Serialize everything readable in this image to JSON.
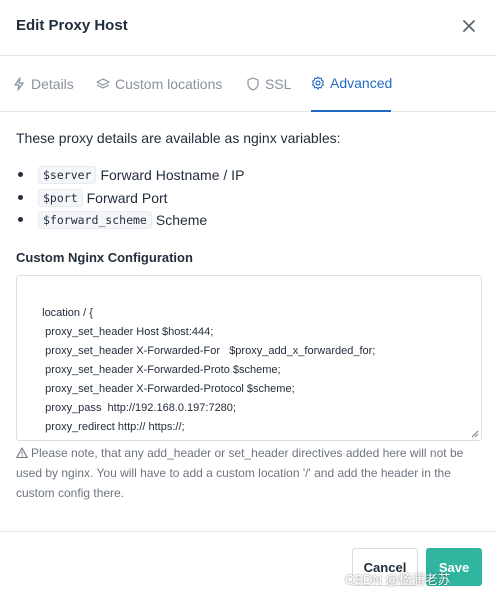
{
  "dialog": {
    "title": "Edit Proxy Host"
  },
  "tabs": [
    {
      "label": "Details",
      "icon": "lightning-icon"
    },
    {
      "label": "Custom locations",
      "icon": "layers-icon"
    },
    {
      "label": "SSL",
      "icon": "shield-icon"
    },
    {
      "label": "Advanced",
      "icon": "gear-icon",
      "active": true
    }
  ],
  "advanced": {
    "intro": "These proxy details are available as nginx variables:",
    "variables": [
      {
        "code": "$server",
        "description": "Forward Hostname / IP"
      },
      {
        "code": "$port",
        "description": "Forward Port"
      },
      {
        "code": "$forward_scheme",
        "description": "Scheme"
      }
    ],
    "config_label": "Custom Nginx Configuration",
    "config_value": "location / {\n   proxy_set_header Host $host:444;\n   proxy_set_header X-Forwarded-For   $proxy_add_x_forwarded_for;\n   proxy_set_header X-Forwarded-Proto $scheme;\n   proxy_set_header X-Forwarded-Protocol $scheme;\n   proxy_pass  http://192.168.0.197:7280;\n   proxy_redirect http:// https://;\n}",
    "note": "Please note, that any add_header or set_header directives added here will not be used by nginx. You will have to add a custom location '/' and add the header in the custom config there."
  },
  "footer": {
    "cancel_label": "Cancel",
    "save_label": "Save"
  },
  "watermark": "CSDN @杨浦老苏",
  "colors": {
    "accent": "#206bc4",
    "save": "#2fb5a0",
    "muted": "#8a929d"
  }
}
